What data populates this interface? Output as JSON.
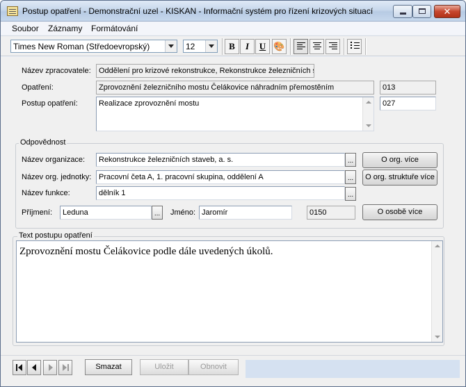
{
  "window": {
    "title": "Postup opatření - Demonstrační uzel - KISKAN - Informační systém pro řízení krizových situací"
  },
  "menu": [
    "Soubor",
    "Záznamy",
    "Formátování"
  ],
  "toolbar": {
    "font_family": "Times New Roman (Středoevropský)",
    "font_size": "12",
    "bold": "B",
    "italic": "I",
    "underline": "U"
  },
  "form": {
    "zpracovatel_label": "Název zpracovatele:",
    "zpracovatel_value": "Oddělení pro krizové rekonstrukce, Rekonstrukce železničních st",
    "opatreni_label": "Opatření:",
    "opatreni_value": "Zprovoznění železničního mostu Čelákovice náhradním přemostěním",
    "opatreni_code": "013",
    "postup_label": "Postup opatření:",
    "postup_value": "Realizace zprovoznění mostu",
    "postup_code": "027"
  },
  "responsibility": {
    "group_title": "Odpovědnost",
    "org_label": "Název organizace:",
    "org_value": "Rekonstrukce železničních staveb, a. s.",
    "org_button": "O org. více",
    "unit_label": "Název org. jednotky:",
    "unit_value": "Pracovní četa A, 1. pracovní skupina, oddělení A",
    "unit_button": "O org. struktuře více",
    "function_label": "Název funkce:",
    "function_value": "dělník 1",
    "surname_label": "Příjmení:",
    "surname_value": "Leduna",
    "name_label": "Jméno:",
    "name_value": "Jaromír",
    "person_code": "0150",
    "person_button": "O osobě více",
    "ellipsis": "..."
  },
  "text_section": {
    "group_title": "Text postupu opatření",
    "content": "Zprovoznění mostu Čelákovice podle dále uvedených úkolů."
  },
  "bottom": {
    "delete": "Smazat",
    "save": "Uložit",
    "restore": "Obnovit"
  }
}
